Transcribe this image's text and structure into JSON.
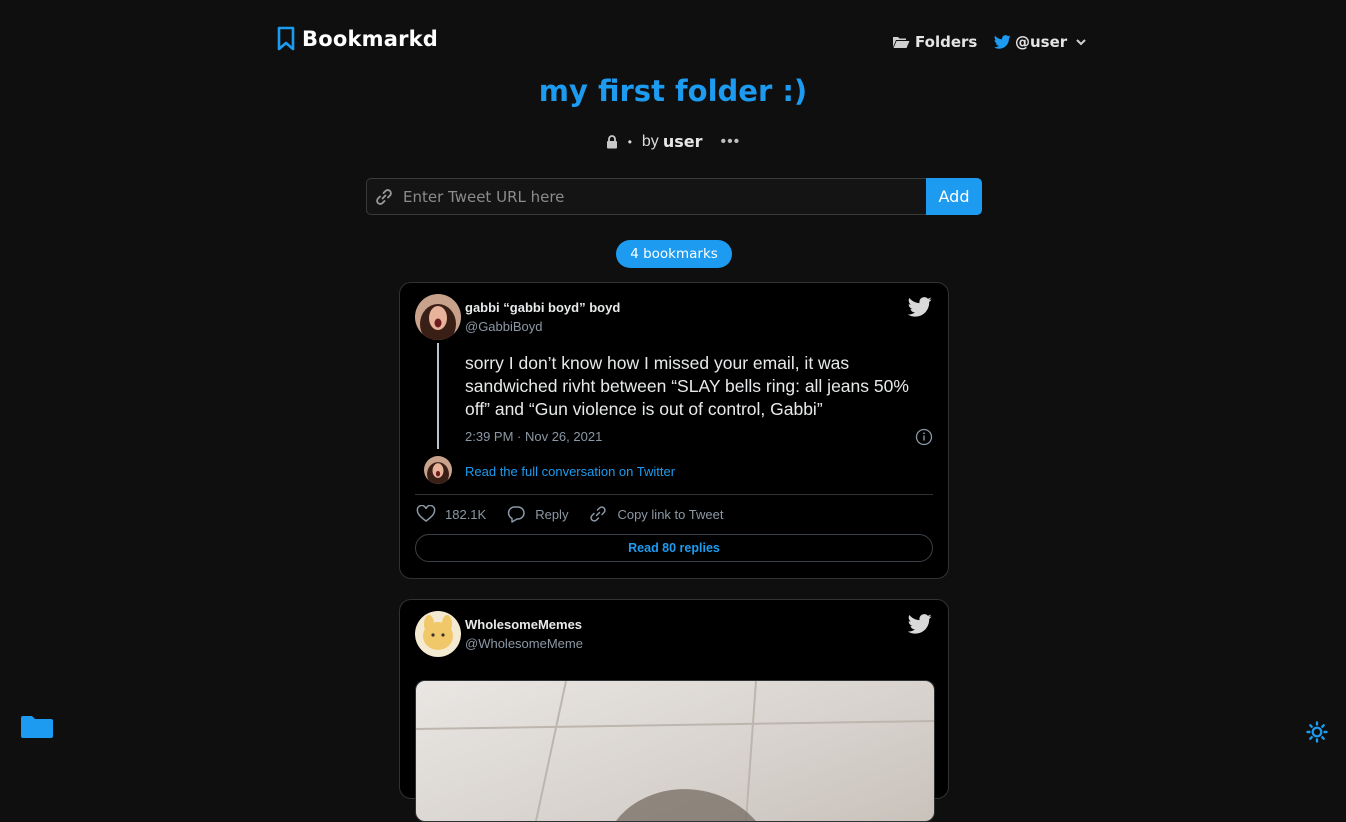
{
  "header": {
    "brand": "Bookmarkd",
    "folders_label": "Folders",
    "user_label": "@user"
  },
  "folder": {
    "title": "my first folder :)",
    "separator": "•",
    "by_label": "by",
    "owner": "user",
    "more": "•••"
  },
  "add_tweet": {
    "placeholder": "Enter Tweet URL here",
    "button_label": "Add"
  },
  "bookmark_count": "4 bookmarks",
  "tweets": [
    {
      "name": "gabbi “gabbi boyd” boyd",
      "handle": "@GabbiBoyd",
      "text": "sorry I don’t know how I missed your email, it was sandwiched rivht between “SLAY bells ring: all jeans 50% off” and “Gun violence is out of control, Gabbi”",
      "time": "2:39 PM · Nov 26, 2021",
      "read_full": "Read the full conversation on Twitter",
      "likes": "182.1K",
      "reply_label": "Reply",
      "copy_label": "Copy link to Tweet",
      "replies_label": "Read 80 replies"
    },
    {
      "name": "WholesomeMemes",
      "handle": "@WholesomeMeme"
    }
  ],
  "colors": {
    "accent": "#1d9bf0",
    "background": "#0f0f0f",
    "card": "#000000"
  },
  "icons": {
    "brand": "bookmark-icon",
    "folders": "folder-open-icon",
    "user": "twitter-icon",
    "dropdown": "chevron-down-icon",
    "privacy": "lock-icon",
    "link": "link-icon",
    "bottom_left": "folder-icon",
    "bottom_right": "sun-icon"
  }
}
